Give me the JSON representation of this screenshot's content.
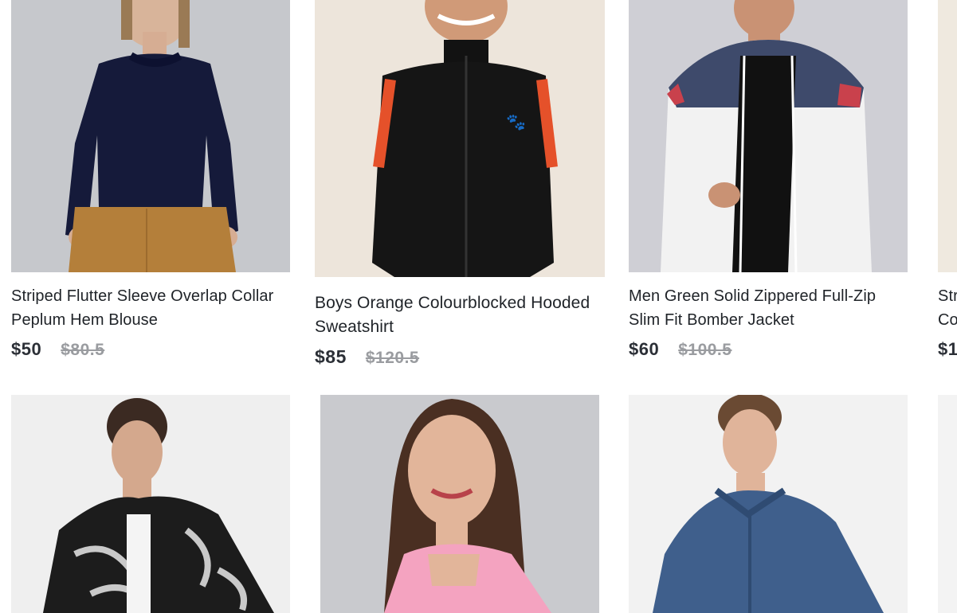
{
  "products": [
    {
      "title": "Striped Flutter Sleeve Overlap Collar Peplum Hem Blouse",
      "price": "$50",
      "old_price": "$80.5"
    },
    {
      "title": "Boys Orange Colourblocked Hooded Sweatshirt",
      "price": "$85",
      "old_price": "$120.5"
    },
    {
      "title": "Men Green Solid Zippered Full-Zip Slim Fit Bomber Jacket",
      "price": "$60",
      "old_price": "$100.5"
    },
    {
      "title": "Str Co",
      "price": "$1",
      "old_price": ""
    }
  ],
  "colors": {
    "price": "#2b2f36",
    "old_price": "#9a9ca0",
    "title": "#1f2328"
  }
}
